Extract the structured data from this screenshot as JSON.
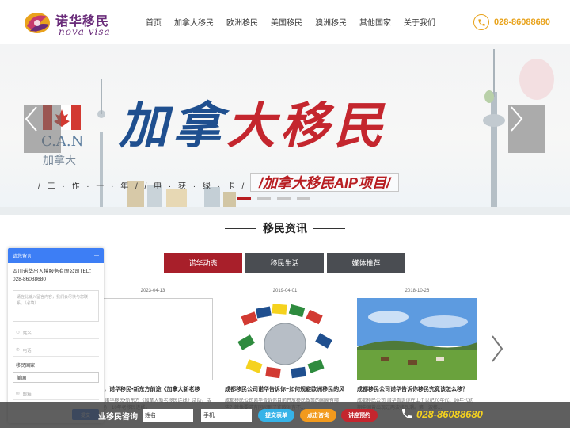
{
  "header": {
    "logo_cn": "诺华移民",
    "logo_en": "nova visa",
    "nav": [
      "首页",
      "加拿大移民",
      "欧洲移民",
      "美国移民",
      "澳洲移民",
      "其他国家",
      "关于我们"
    ],
    "phone": "028-86088680"
  },
  "banner": {
    "title_blue": "加拿",
    "title_red": "大移民",
    "subtitle": "/加拿大移民AIP项目/",
    "slogan": "/ 工 · 作 · 一 · 年 /     / 申 · 获 · 绿 · 卡 /",
    "can_label": "C.A.N",
    "can_cn": "加拿大",
    "dots": 4,
    "active_dot": 0
  },
  "section": {
    "title": "移民资讯",
    "tabs": [
      "诺华动态",
      "移民生活",
      "媒体推荐"
    ],
    "active_tab": 0
  },
  "cards": [
    {
      "date": "2023-04-13",
      "title": "回顾，诺华移民•新东方前途《加拿大新老移",
      "desc": "2日，诺华移民•新东方《加拿大新老移民连线》活动，活动现场，10年老移民连线，"
    },
    {
      "date": "2019-04-01",
      "title": "成都移民公司诺华告诉你~如何规避欧洲移民的风",
      "desc": "成都移民公司诺华告诉你目前开放移民政策的国家有哪些？就像要求有同起到了往欧洲有不..."
    },
    {
      "date": "2018-10-26",
      "title": "成都移民公司诺华告诉你移民究竟该怎么移？",
      "desc": "成都移民公司 诺华告诉你在上个世纪70年代、90年代初期中国曾出现过两波移民潮。第一波移..."
    }
  ],
  "chat": {
    "header": "请您留言",
    "minimize": "—",
    "company": "四川诺华出入境服务有限公司TEL：028-86088680",
    "message_placeholder": "请在此输入留言内容，我们会尽快与您联系。（必填）",
    "name_placeholder": "姓名",
    "phone_placeholder": "电话",
    "country_label": "移民国家",
    "country_value": "美国",
    "email_placeholder": "邮箱",
    "submit": "提交"
  },
  "bottom_bar": {
    "label": "业移民咨询",
    "name_value": "姓名",
    "phone_value": "手机",
    "btn_submit": "提交表单",
    "btn_consult": "点击咨询",
    "btn_reserve": "讲座预约",
    "phone": "028-86088680"
  },
  "colors": {
    "brand_purple": "#6a2c7a",
    "accent_orange": "#e8a21a",
    "tab_active": "#a81f2a",
    "tab_inactive": "#4a4d52",
    "chat_blue": "#3d7ef5",
    "phone_yellow": "#f5d21e"
  }
}
